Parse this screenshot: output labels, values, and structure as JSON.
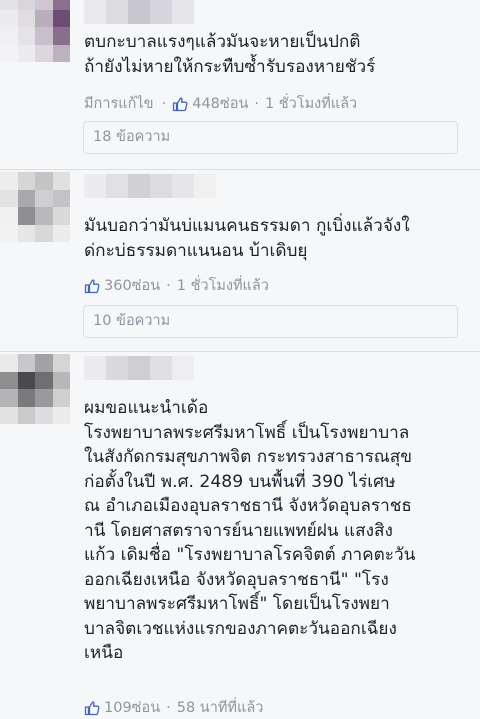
{
  "comments": [
    {
      "text": "ตบกะบาลแรงๆแล้วมันจะหายเป็นปกติ\nถ้ายังไม่หายให้กระทืบซ้ำรับรองหายชัวร์",
      "edited_label": "มีการแก้ไข",
      "likes": "448ซ่อน",
      "time": "1 ชั่วโมงที่แล้ว",
      "replies": "18 ข้อความ"
    },
    {
      "text": "มันบอกว่ามันบ่แมนคนธรรมดา กูเบิ่งแล้วจังใ\nด่กะบ่ธรรมดาแนนอน บ้าเดิบยุ",
      "likes": "360ซ่อน",
      "time": "1 ชั่วโมงที่แล้ว",
      "replies": "10 ข้อความ"
    },
    {
      "text": "ผมขอแนะนำเด้อ\nโรงพยาบาลพระศรีมหาโพธิ์ เป็นโรงพยาบาล\nในสังกัดกรมสุขภาพจิต กระทรวงสาธารณสุข\nก่อตั้งในปี พ.ศ. 2489 บนพื้นที่ 390 ไร่เศษ\nณ อำเภอเมืองอุบลราชธานี จังหวัดอุบลราชธ\nานี โดยศาสตราจารย์นายแพทย์ฝน แสงสิง\nแก้ว เดิมชื่อ \"โรงพยาบาลโรคจิตต์ ภาคตะวัน\nออกเฉียงเหนือ จังหวัดอุบลราชธานี\" \"โรง\nพยาบาลพระศรีมหาโพธิ์\" โดยเป็นโรงพยา\nบาลจิตเวชแห่งแรกของภาคตะวันออกเฉียง\nเหนือ",
      "likes": "109ซ่อน",
      "time": "58 นาทีที่แล้ว"
    }
  ],
  "icons": {
    "like": "thumbs-up-icon"
  },
  "colors": {
    "meta": "#90949c",
    "like": "#4267b2",
    "text": "#1d2129"
  }
}
